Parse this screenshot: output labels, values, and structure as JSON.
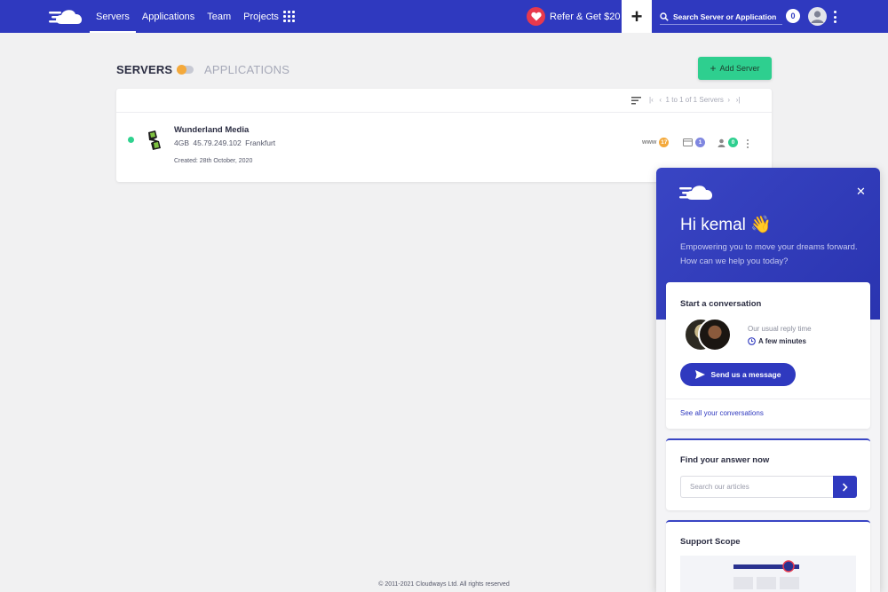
{
  "nav": {
    "items": [
      {
        "label": "Servers",
        "active": true
      },
      {
        "label": "Applications",
        "active": false
      },
      {
        "label": "Team",
        "active": false
      },
      {
        "label": "Projects",
        "active": false
      }
    ],
    "refer_label": "Refer & Get $20",
    "search_placeholder": "Search Server or Application",
    "notification_count": "0"
  },
  "page": {
    "title": "SERVERS",
    "alt_title": "APPLICATIONS",
    "add_server_label": "Add Server",
    "pagination": "1 to 1 of 1 Servers"
  },
  "server": {
    "name": "Wunderland Media",
    "size": "4GB",
    "ip": "45.79.249.102",
    "location": "Frankfurt",
    "created": "Created: 28th October, 2020",
    "stats": [
      {
        "icon": "www-icon",
        "count": "17",
        "color": "#f4a93b"
      },
      {
        "icon": "app-icon",
        "count": "1",
        "color": "#7f86e0"
      },
      {
        "icon": "user-icon",
        "count": "0",
        "color": "#2ecf8f"
      }
    ],
    "status_color": "#2fd28f"
  },
  "footer": "© 2011-2021 Cloudways Ltd. All rights reserved",
  "widget": {
    "greeting": "Hi kemal 👋",
    "subtitle": "Empowering you to move your dreams forward. How can we help you today?",
    "conversation_title": "Start a conversation",
    "reply_label": "Our usual reply time",
    "reply_value": "A few minutes",
    "send_label": "Send us a message",
    "see_all_label": "See all your conversations",
    "find_title": "Find your answer now",
    "search_placeholder": "Search our articles",
    "scope_title": "Support Scope"
  },
  "colors": {
    "brand": "#2f39bf",
    "accent_green": "#2ecf8f",
    "heart": "#e8394d"
  }
}
